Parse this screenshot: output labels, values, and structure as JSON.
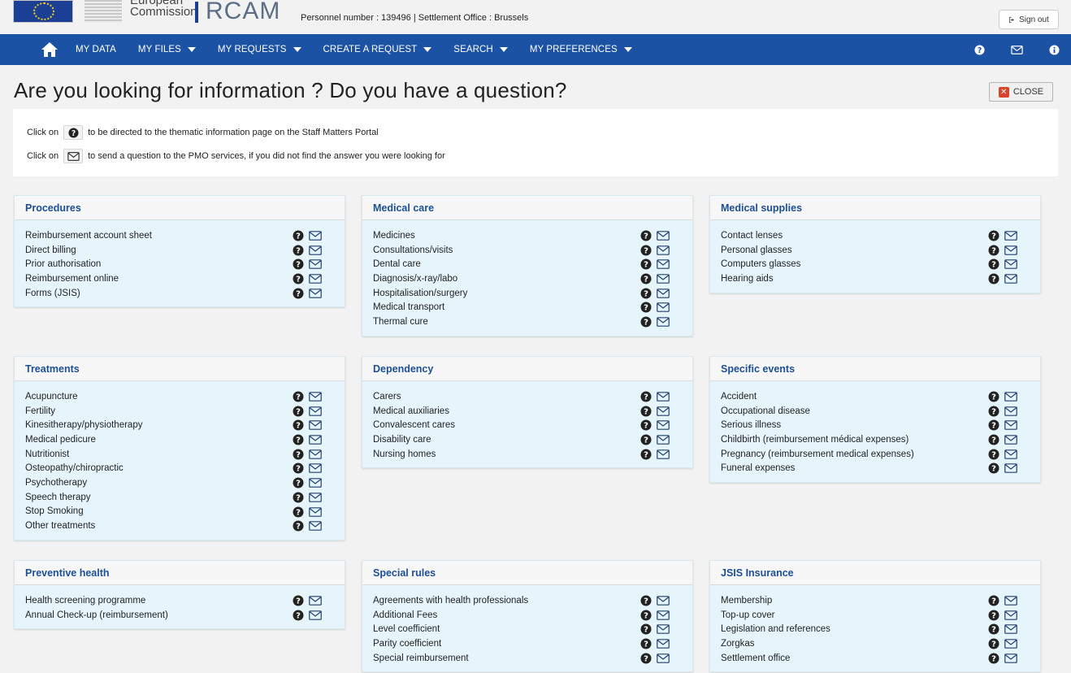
{
  "header": {
    "ec_text_top": "European",
    "ec_text_bottom": "Commission",
    "app_name": "RCAM",
    "personnel_info": "Personnel number : 139496 | Settlement Office : Brussels",
    "sign_out_label": "Sign out"
  },
  "nav": {
    "items": [
      {
        "label": "MY DATA",
        "dropdown": false
      },
      {
        "label": "MY FILES",
        "dropdown": true
      },
      {
        "label": "MY REQUESTS",
        "dropdown": true
      },
      {
        "label": "CREATE A REQUEST",
        "dropdown": true
      },
      {
        "label": "SEARCH",
        "dropdown": true
      },
      {
        "label": "MY PREFERENCES",
        "dropdown": true
      }
    ],
    "right_icons": [
      "question-icon",
      "mail-icon",
      "info-icon"
    ]
  },
  "page": {
    "title": "Are you looking for information ? Do you have a question?",
    "close_label": "CLOSE",
    "info_line1_prefix": "Click on",
    "info_line1_suffix": "to be directed to the thematic information page on the Staff Matters Portal",
    "info_line2_prefix": "Click on",
    "info_line2_suffix": "to send a question to the PMO services, if you did not find the answer you were looking for"
  },
  "colors": {
    "nav_blue": "#1c52a3",
    "panel_bg": "#e6f5fc",
    "heading_blue": "#1c4f95",
    "close_red": "#d9432a"
  },
  "categories": [
    {
      "title": "Procedures",
      "items": [
        "Reimbursement account sheet",
        "Direct billing",
        "Prior authorisation",
        "Reimbursement online",
        "Forms (JSIS)"
      ]
    },
    {
      "title": "Medical care",
      "items": [
        "Medicines",
        "Consultations/visits",
        "Dental care",
        "Diagnosis/x-ray/labo",
        "Hospitalisation/surgery",
        "Medical transport",
        "Thermal cure"
      ]
    },
    {
      "title": "Medical supplies",
      "items": [
        "Contact lenses",
        "Personal glasses",
        "Computers glasses",
        "Hearing aids"
      ]
    },
    {
      "title": "Treatments",
      "items": [
        "Acupuncture",
        "Fertility",
        "Kinesitherapy/physiotherapy",
        "Medical pedicure",
        "Nutritionist",
        "Osteopathy/chiropractic",
        "Psychotherapy",
        "Speech therapy",
        "Stop Smoking",
        "Other treatments"
      ]
    },
    {
      "title": "Dependency",
      "items": [
        "Carers",
        "Medical auxiliaries",
        "Convalescent cares",
        "Disability care",
        "Nursing homes"
      ]
    },
    {
      "title": "Specific events",
      "items": [
        "Accident",
        "Occupational disease",
        "Serious illness",
        "Childbirth (reimbursement médical expenses)",
        "Pregnancy (reimbursement medical expenses)",
        "Funeral expenses"
      ]
    },
    {
      "title": "Preventive health",
      "items": [
        "Health screening programme",
        "Annual Check-up (reimbursement)"
      ]
    },
    {
      "title": "Special rules",
      "items": [
        "Agreements with health professionals",
        "Additional Fees",
        "Level coefficient",
        "Parity coefficient",
        "Special reimbursement"
      ]
    },
    {
      "title": "JSIS Insurance",
      "items": [
        "Membership",
        "Top-up cover",
        "Legislation and references",
        "Zorgkas",
        "Settlement office"
      ]
    }
  ]
}
